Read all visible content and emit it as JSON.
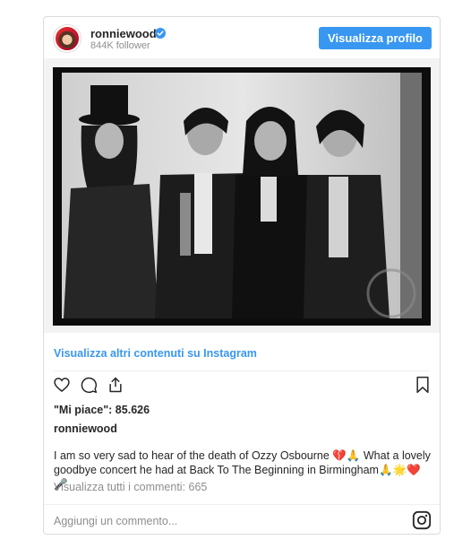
{
  "post": {
    "username": "ronniewood",
    "followers": "844K follower",
    "view_profile_label": "Visualizza profilo",
    "more_link": "Visualizza altri contenuti su Instagram",
    "likes": "\"Mi piace\": 85.626",
    "caption_username": "ronniewood",
    "caption": "I am so very sad to hear of the death of Ozzy Osbourne 💔🙏 What a lovely goodbye concert he had at Back To The Beginning in Birmingham🙏🌟❤️🎤",
    "comments_link": "Visualizza tutti i commenti: 665",
    "comment_placeholder": "Aggiungi un commento..."
  },
  "icons": [
    "verified-icon",
    "heart-icon",
    "comment-icon",
    "share-icon",
    "bookmark-icon",
    "instagram-icon"
  ],
  "colors": {
    "accent": "#3897f0",
    "text": "#262626",
    "muted": "#8e8e8e",
    "border": "#dbdbdb"
  }
}
